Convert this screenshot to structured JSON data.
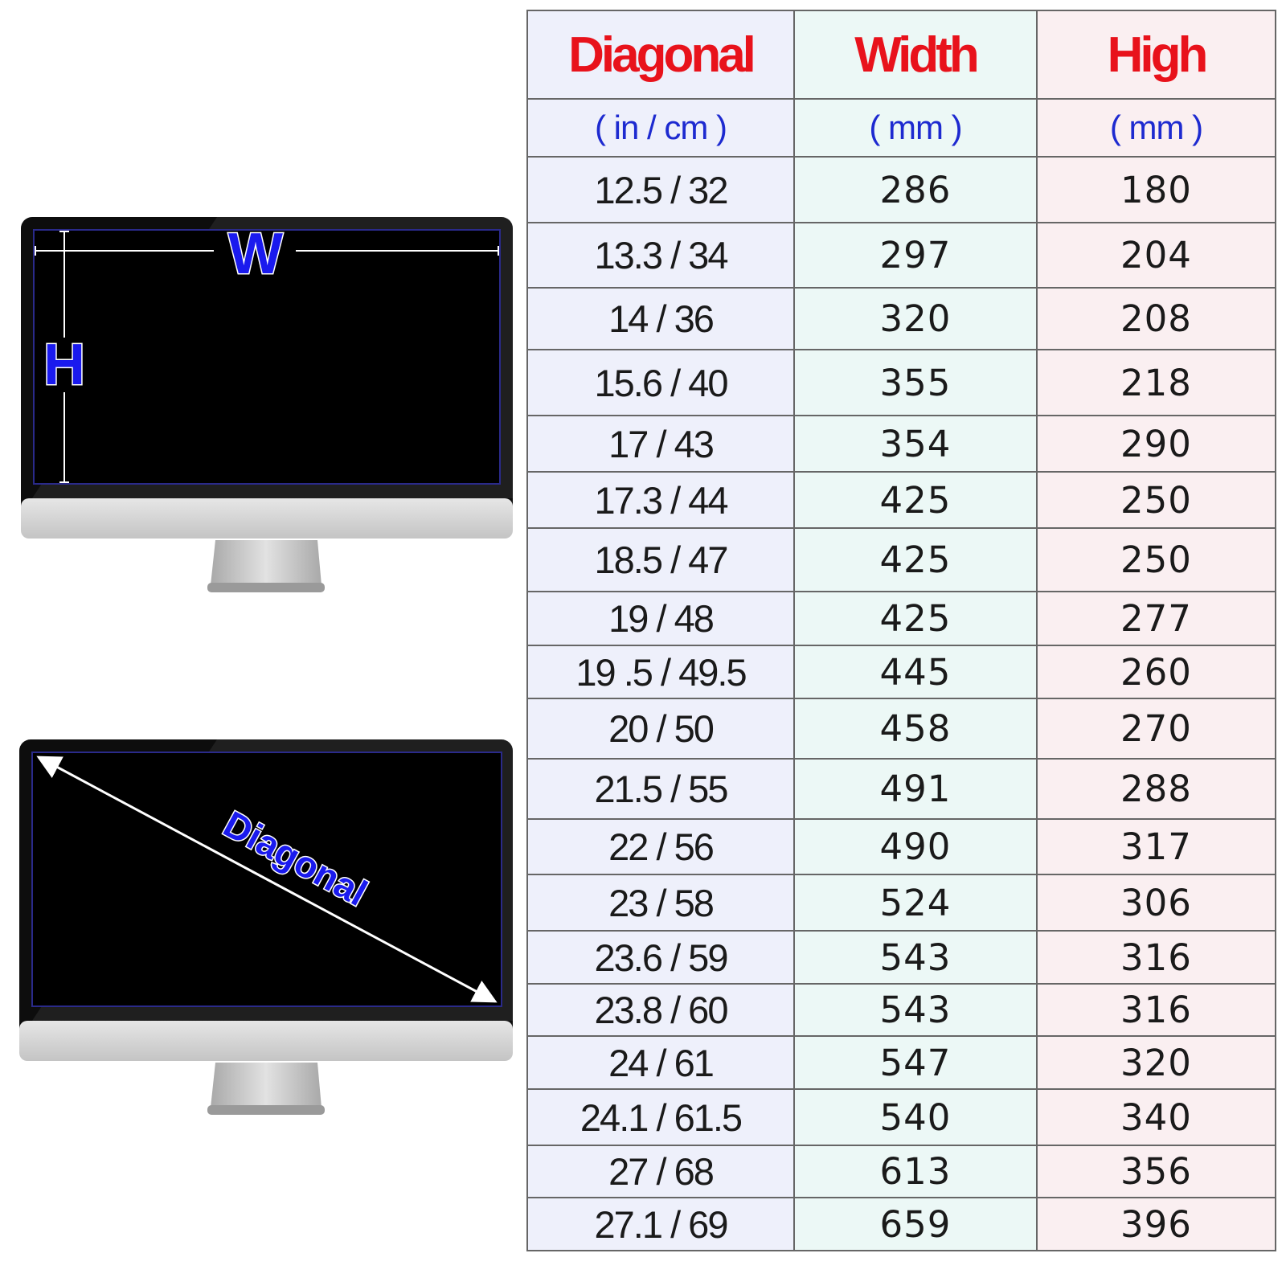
{
  "monitor_labels": {
    "width_letter": "W",
    "height_letter": "H",
    "diagonal_word": "Diagonal"
  },
  "table": {
    "headers": [
      "Diagonal",
      "Width",
      "High"
    ],
    "units": [
      "( in / cm )",
      "( mm )",
      "( mm )"
    ],
    "rows": [
      [
        "12.5 / 32",
        "286",
        "180"
      ],
      [
        "13.3 / 34",
        "297",
        "204"
      ],
      [
        "14 / 36",
        "320",
        "208"
      ],
      [
        "15.6 / 40",
        "355",
        "218"
      ],
      [
        "17 / 43",
        "354",
        "290"
      ],
      [
        "17.3 / 44",
        "425",
        "250"
      ],
      [
        "18.5 / 47",
        "425",
        "250"
      ],
      [
        "19 / 48",
        "425",
        "277"
      ],
      [
        "19 .5 / 49.5",
        "445",
        "260"
      ],
      [
        "20 / 50",
        "458",
        "270"
      ],
      [
        "21.5 / 55",
        "491",
        "288"
      ],
      [
        "22 / 56",
        "490",
        "317"
      ],
      [
        "23 / 58",
        "524",
        "306"
      ],
      [
        "23.6 / 59",
        "543",
        "316"
      ],
      [
        "23.8 / 60",
        "543",
        "316"
      ],
      [
        "24 / 61",
        "547",
        "320"
      ],
      [
        "24.1 / 61.5",
        "540",
        "340"
      ],
      [
        "27 / 68",
        "613",
        "356"
      ],
      [
        "27.1 / 69",
        "659",
        "396"
      ]
    ]
  },
  "colors": {
    "header_text": "#e8121b",
    "unit_text": "#1d2ad0",
    "label_fill": "#1a1aee",
    "col_diagonal_bg": "#eef0fb",
    "col_width_bg": "#ecf8f6",
    "col_high_bg": "#faeff1"
  }
}
